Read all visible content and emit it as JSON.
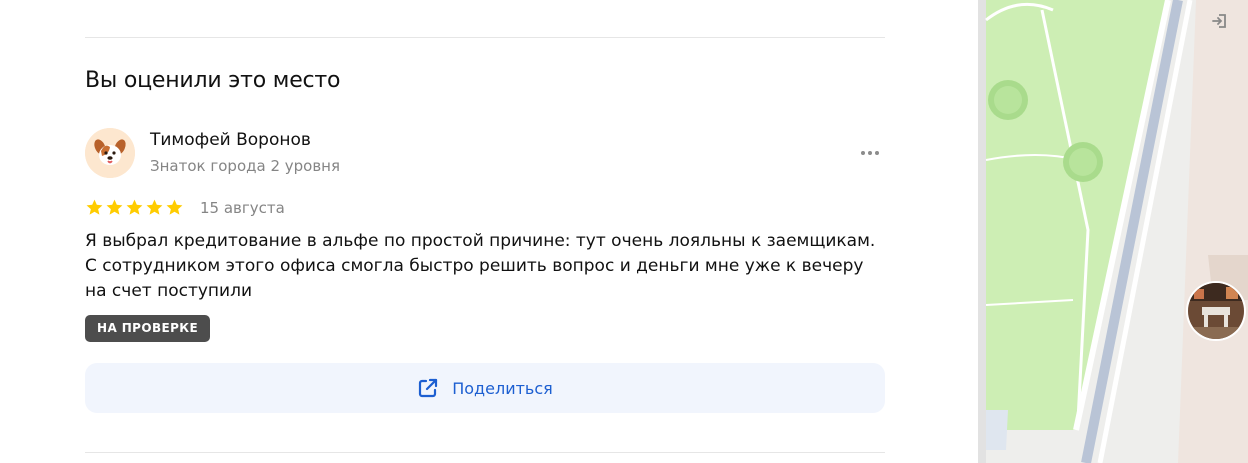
{
  "section": {
    "title": "Вы оценили это место"
  },
  "review": {
    "author_name": "Тимофей Воронов",
    "author_level": "Знаток города 2 уровня",
    "rating": 5,
    "rating_max": 5,
    "date": "15 августа",
    "text": "Я выбрал кредитование в альфе по простой причине: тут очень лояльны к заемщикам. С сотрудником этого офиса смогла быстро решить вопрос и деньги мне уже к вечеру на счет поступили",
    "status_badge": "НА ПРОВЕРКЕ",
    "more_icon": "more-dots-icon",
    "avatar_icon": "dog-avatar-icon"
  },
  "share": {
    "label": "Поделиться",
    "icon": "share-icon"
  },
  "map": {
    "login_icon": "login-icon"
  },
  "colors": {
    "star": "#fc0",
    "accent": "#1d5fd1",
    "share_bg": "#f1f5fd",
    "badge_bg": "#4d4d4d",
    "secondary_text": "#858585",
    "map_park": "#cdeeb4"
  }
}
